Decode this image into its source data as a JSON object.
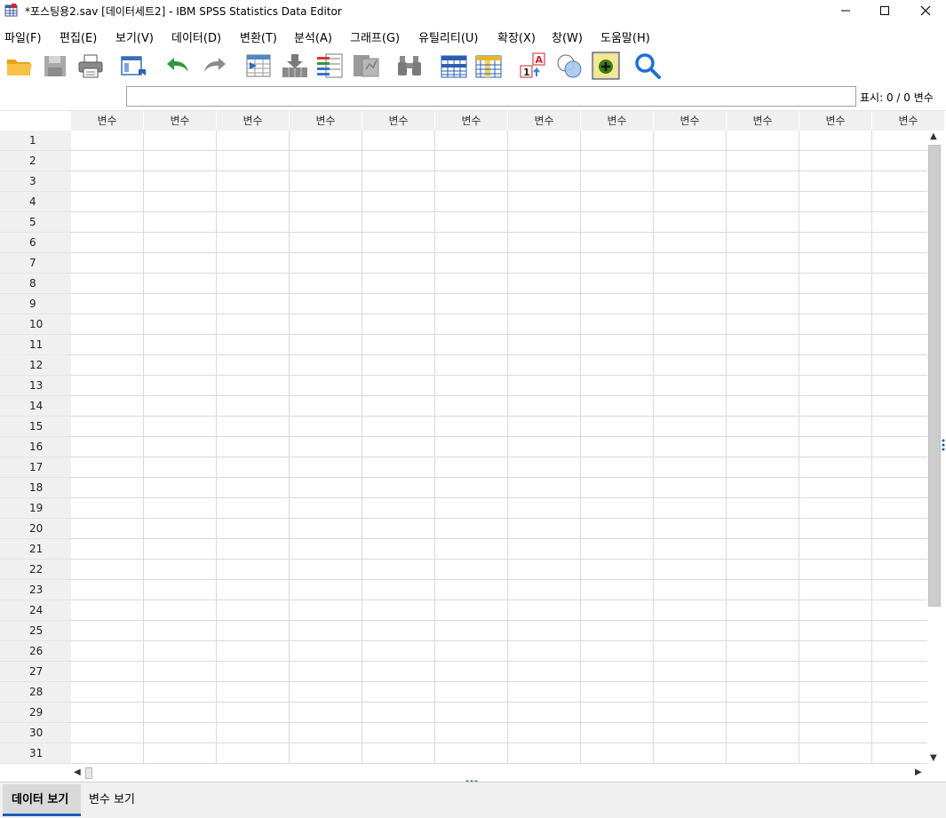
{
  "window": {
    "title": "*포스팅용2.sav [데이터세트2] - IBM SPSS Statistics Data Editor",
    "minimize_icon": "minimize-icon",
    "maximize_icon": "maximize-icon",
    "close_icon": "close-icon"
  },
  "menu": [
    {
      "label": "파일(F)"
    },
    {
      "label": "편집(E)"
    },
    {
      "label": "보기(V)"
    },
    {
      "label": "데이터(D)"
    },
    {
      "label": "변환(T)"
    },
    {
      "label": "분석(A)"
    },
    {
      "label": "그래프(G)"
    },
    {
      "label": "유틸리티(U)"
    },
    {
      "label": "확장(X)"
    },
    {
      "label": "창(W)"
    },
    {
      "label": "도움말(H)"
    }
  ],
  "toolbar": {
    "icons": [
      "open-folder-icon",
      "save-icon",
      "print-icon",
      "recall-dialog-icon",
      "undo-icon",
      "redo-icon",
      "goto-case-icon",
      "goto-variable-icon",
      "variables-icon",
      "run-descriptives-icon",
      "find-icon",
      "insert-cases-icon",
      "insert-variable-icon",
      "value-labels-icon",
      "use-variable-sets-icon",
      "show-all-variables-icon",
      "spelling-icon"
    ]
  },
  "editbar": {
    "value": "",
    "visible_count": "표시: 0 / 0 변수"
  },
  "grid": {
    "column_label": "변수",
    "columns": [
      "변수",
      "변수",
      "변수",
      "변수",
      "변수",
      "변수",
      "변수",
      "변수",
      "변수",
      "변수",
      "변수",
      "변수"
    ],
    "rows": [
      "1",
      "2",
      "3",
      "4",
      "5",
      "6",
      "7",
      "8",
      "9",
      "10",
      "11",
      "12",
      "13",
      "14",
      "15",
      "16",
      "17",
      "18",
      "19",
      "20",
      "21",
      "22",
      "23",
      "24",
      "25",
      "26",
      "27",
      "28",
      "29",
      "30",
      "31"
    ]
  },
  "tabs": {
    "data_view": "데이터 보기",
    "variable_view": "변수 보기",
    "active": "data_view"
  },
  "colors": {
    "accent": "#1a5fb4",
    "header_bg": "#f0f0f0",
    "grid_line": "#dadada"
  }
}
